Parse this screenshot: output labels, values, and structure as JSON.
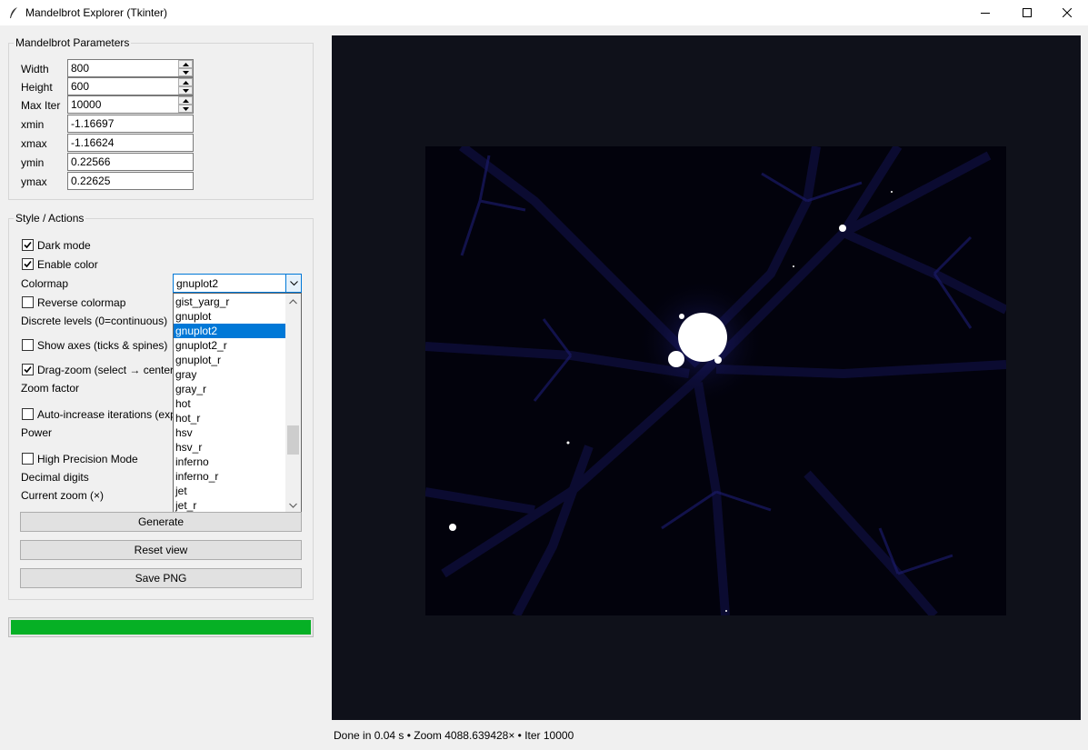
{
  "window": {
    "title": "Mandelbrot Explorer (Tkinter)"
  },
  "params": {
    "group_label": "Mandelbrot Parameters",
    "fields": [
      {
        "label": "Width",
        "value": "800"
      },
      {
        "label": "Height",
        "value": "600"
      },
      {
        "label": "Max Iter",
        "value": "10000"
      },
      {
        "label": "xmin",
        "value": "-1.16697"
      },
      {
        "label": "xmax",
        "value": "-1.16624"
      },
      {
        "label": "ymin",
        "value": "0.22566"
      },
      {
        "label": "ymax",
        "value": "0.22625"
      }
    ]
  },
  "style": {
    "group_label": "Style / Actions",
    "dark_mode": {
      "label": "Dark mode",
      "checked": true
    },
    "enable_color": {
      "label": "Enable color",
      "checked": true
    },
    "colormap_label": "Colormap",
    "colormap_value": "gnuplot2",
    "reverse_colormap": {
      "label": "Reverse colormap",
      "checked": false
    },
    "discrete_levels_label": "Discrete levels (0=continuous)",
    "show_axes": {
      "label": "Show axes (ticks & spines)",
      "checked": false
    },
    "drag_zoom": {
      "label": "Drag-zoom (select → center",
      "checked": true
    },
    "zoom_factor_label": "Zoom factor",
    "auto_increase": {
      "label": "Auto-increase iterations (exp",
      "checked": false
    },
    "power_label": "Power",
    "high_precision": {
      "label": "High Precision Mode",
      "checked": false
    },
    "decimal_digits_label": "Decimal digits",
    "current_zoom_label": "Current zoom (×)"
  },
  "colormap_list": {
    "items": [
      "gist_yarg_r",
      "gnuplot",
      "gnuplot2",
      "gnuplot2_r",
      "gnuplot_r",
      "gray",
      "gray_r",
      "hot",
      "hot_r",
      "hsv",
      "hsv_r",
      "inferno",
      "inferno_r",
      "jet",
      "jet_r"
    ],
    "selected": "gnuplot2"
  },
  "actions": {
    "generate": "Generate",
    "reset": "Reset view",
    "save": "Save PNG"
  },
  "progress": {
    "percent": 100,
    "color": "#06b025"
  },
  "status": {
    "text": "Done in 0.04 s • Zoom 4088.639428× • Iter 10000"
  },
  "colors": {
    "canvas_bg": "#0f111a",
    "plot_bg": "#02020c",
    "accent": "#0078d7"
  }
}
